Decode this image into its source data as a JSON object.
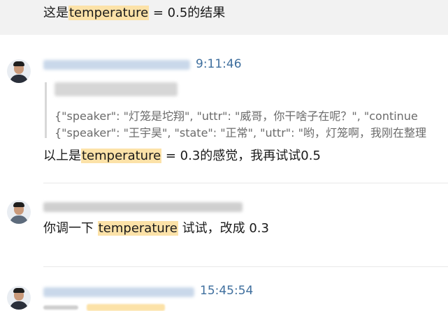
{
  "messages": [
    {
      "pre": "这是",
      "highlight": "temperature",
      "post": " = 0.5的结果"
    },
    {
      "time": "9:11:46",
      "quote_lines": [
        "{\"speaker\": \"灯笼是坨翔\", \"uttr\": \"威哥，你干啥子在呢？\", \"continue",
        "{\"speaker\": \"王宇昊\", \"state\": \"正常\", \"uttr\": \"哟，灯笼啊，我刚在整理"
      ],
      "pre": "以上是",
      "highlight": "temperature",
      "post": " = 0.3的感觉，我再试试0.5"
    },
    {
      "pre": "你调一下 ",
      "highlight": "temperature",
      "post": " 试试，改成 0.3"
    },
    {
      "time": "15:45:54"
    }
  ]
}
